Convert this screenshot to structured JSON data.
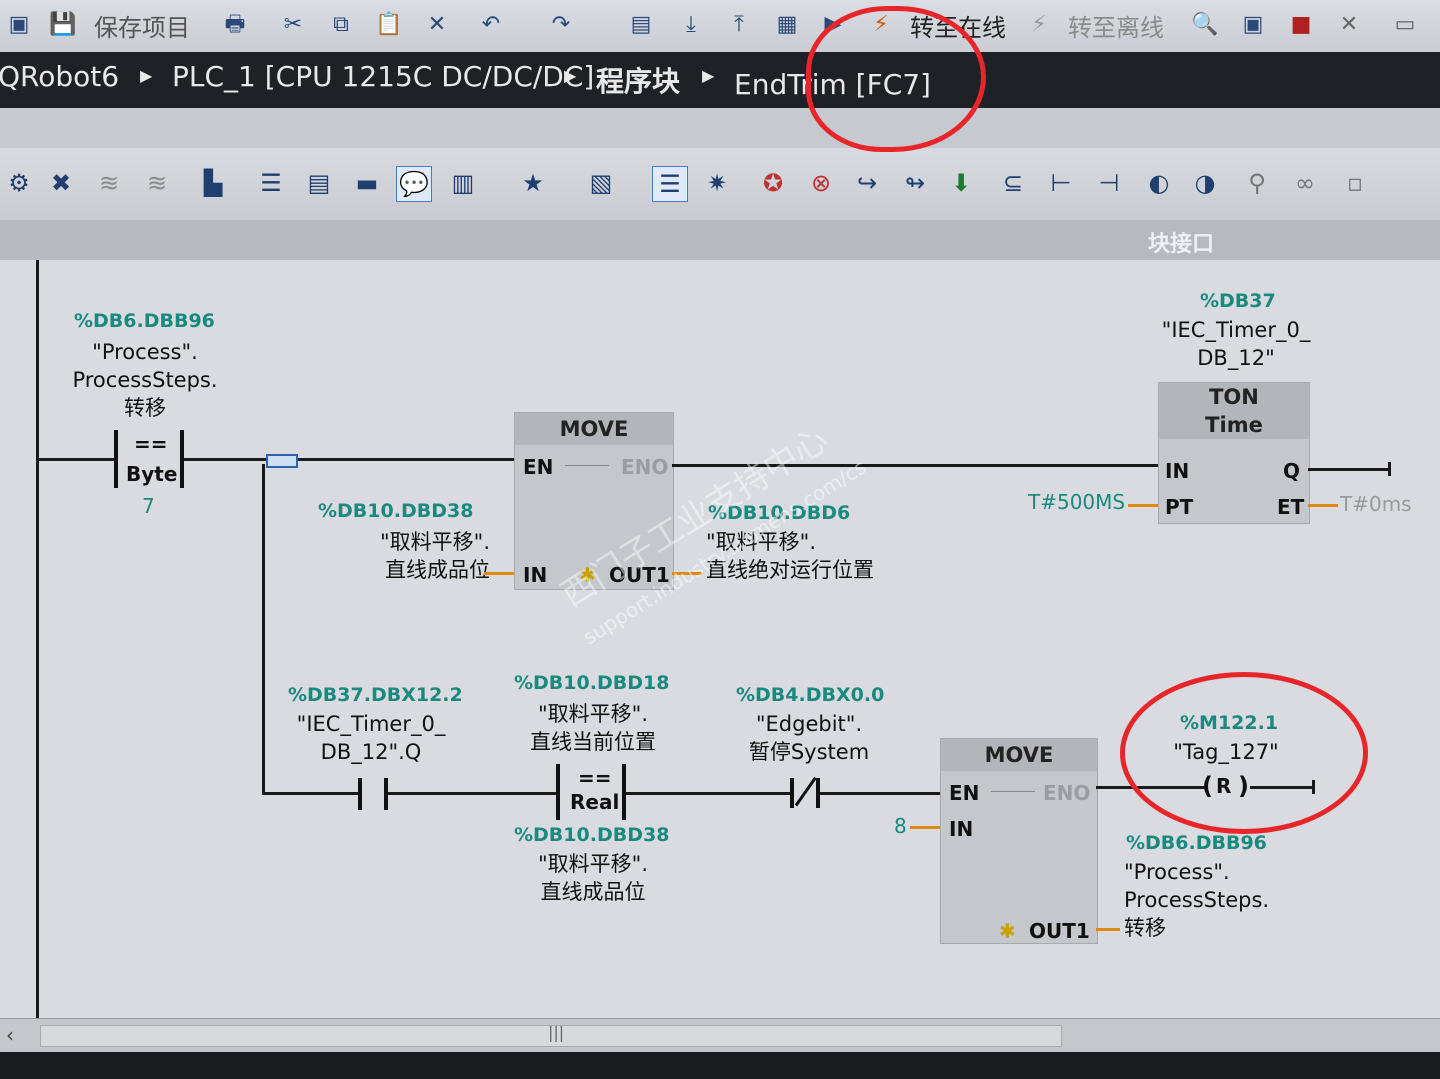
{
  "toolbar": {
    "save_project": "保存项目",
    "go_online": "转至在线",
    "go_offline": "转至离线"
  },
  "breadcrumb": {
    "project": "QRobot6",
    "plc": "PLC_1 [CPU 1215C DC/DC/DC]",
    "program_blocks": "程序块",
    "block": "EndTrim [FC7]"
  },
  "editor": {
    "block_interface": "块接口"
  },
  "network": {
    "cmp1": {
      "addr": "%DB6.DBB96",
      "line1": "\"Process\".",
      "line2": "ProcessSteps.",
      "line3": "转移",
      "op": "==",
      "type": "Byte",
      "value": "7"
    },
    "move1": {
      "title": "MOVE",
      "en": "EN",
      "eno": "ENO",
      "in": "IN",
      "out": "OUT1",
      "in_addr": "%DB10.DBD38",
      "in_line1": "\"取料平移\".",
      "in_line2": "直线成品位",
      "out_addr": "%DB10.DBD6",
      "out_line1": "\"取料平移\".",
      "out_line2": "直线绝对运行位置"
    },
    "timer": {
      "addr": "%DB37",
      "line1": "\"IEC_Timer_0_",
      "line2": "DB_12\"",
      "title": "TON",
      "subtitle": "Time",
      "in": "IN",
      "q": "Q",
      "pt": "PT",
      "et": "ET",
      "pt_value": "T#500MS",
      "et_value": "T#0ms"
    },
    "contact_q": {
      "addr": "%DB37.DBX12.2",
      "line1": "\"IEC_Timer_0_",
      "line2": "DB_12\".Q"
    },
    "cmp2": {
      "addr": "%DB10.DBD18",
      "line1": "\"取料平移\".",
      "line2": "直线当前位置",
      "op": "==",
      "type": "Real",
      "addr2": "%DB10.DBD38",
      "line3": "\"取料平移\".",
      "line4": "直线成品位"
    },
    "edge": {
      "addr": "%DB4.DBX0.0",
      "line1": "\"Edgebit\".",
      "line2": "暂停System"
    },
    "move2": {
      "title": "MOVE",
      "en": "EN",
      "eno": "ENO",
      "in": "IN",
      "out": "OUT1",
      "in_value": "8",
      "out_addr": "%DB6.DBB96",
      "out_line1": "\"Process\".",
      "out_line2": "ProcessSteps.",
      "out_line3": "转移"
    },
    "coil": {
      "addr": "%M122.1",
      "line1": "\"Tag_127\"",
      "symbol": "R"
    }
  },
  "watermark": {
    "text": "西门子工业支持中心",
    "url": "support.industry.siemens.com/cs"
  },
  "colors": {
    "annotation": "#e8262a",
    "address": "#1b8a7e",
    "wire": "#1a1a1a"
  }
}
